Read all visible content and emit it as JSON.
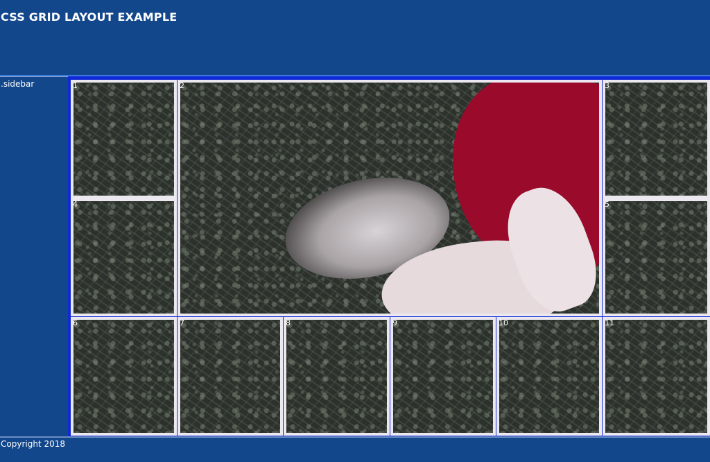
{
  "header": {
    "title": "CSS GRID LAYOUT EXAMPLE"
  },
  "sidebar": {
    "label": ".sidebar"
  },
  "grid": {
    "items": [
      {
        "number": "1",
        "image": "grass-photo"
      },
      {
        "number": "2",
        "image": "person-lying-in-grass-photo"
      },
      {
        "number": "3",
        "image": "grass-photo"
      },
      {
        "number": "4",
        "image": "grass-photo"
      },
      {
        "number": "5",
        "image": "grass-photo"
      },
      {
        "number": "6",
        "image": "grass-photo"
      },
      {
        "number": "7",
        "image": "grass-photo"
      },
      {
        "number": "8",
        "image": "grass-photo"
      },
      {
        "number": "9",
        "image": "grass-photo"
      },
      {
        "number": "10",
        "image": "grass-photo"
      },
      {
        "number": "11",
        "image": "grass-photo"
      }
    ]
  },
  "footer": {
    "text": "Copyright 2018"
  },
  "colors": {
    "background": "#13478c",
    "grid_gap": "#1029d6",
    "cell_border": "#ebe8ef",
    "accent_red": "#9a0a2b"
  }
}
